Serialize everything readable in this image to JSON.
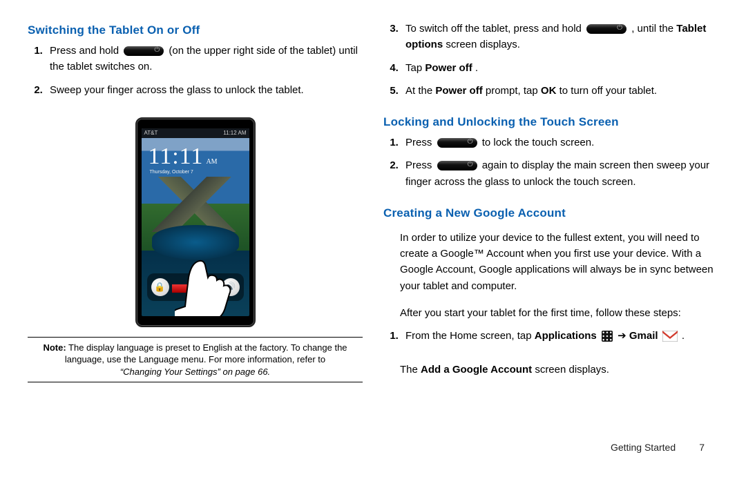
{
  "left": {
    "heading": "Switching the Tablet On or Off",
    "steps": {
      "s1a": "Press and hold ",
      "s1b": " (on the upper right side of the tablet) until the tablet switches on.",
      "s2": "Sweep your finger across the glass to unlock the tablet."
    },
    "device": {
      "carrier": "AT&T",
      "status_time": "11:12 AM",
      "clock": "11:11",
      "ampm": "AM",
      "date": "Thursday, October 7"
    },
    "note": {
      "label": "Note:",
      "body": " The display language is preset to English at the factory. To change the language, use the Language menu. For more information, refer to ",
      "ref": "“Changing Your Settings”",
      "ref_tail": "  on page 66."
    }
  },
  "right": {
    "cont_steps": {
      "s3a": "To switch off the tablet, press and hold ",
      "s3b": ", until the ",
      "s3c": "Tablet options",
      "s3d": " screen displays.",
      "s4a": "Tap ",
      "s4b": "Power off",
      "s4c": ".",
      "s5a": "At the ",
      "s5b": "Power off",
      "s5c": " prompt, tap ",
      "s5d": "OK",
      "s5e": " to turn off your tablet."
    },
    "h2": "Locking and Unlocking the Touch Screen",
    "lock_steps": {
      "l1a": "Press ",
      "l1b": " to lock the touch screen.",
      "l2a": "Press ",
      "l2b": " again to display the main screen then sweep your finger across the glass to unlock the touch screen."
    },
    "h3": "Creating a New Google Account",
    "google_para1": "In order to utilize your device to the fullest extent, you will need to create a Google™ Account when you first use your device. With a Google Account, Google applications will always be in sync between your tablet and computer.",
    "google_para2": "After you start your tablet for the first time, follow these steps:",
    "g_steps": {
      "g1a": "From the Home screen, tap ",
      "g1b": "Applications",
      "g1c": " ➔ ",
      "g1d": "Gmail",
      "g1e": "."
    },
    "g_result_a": "The ",
    "g_result_b": "Add a Google Account",
    "g_result_c": " screen displays."
  },
  "footer": {
    "section": "Getting Started",
    "page": "7"
  }
}
